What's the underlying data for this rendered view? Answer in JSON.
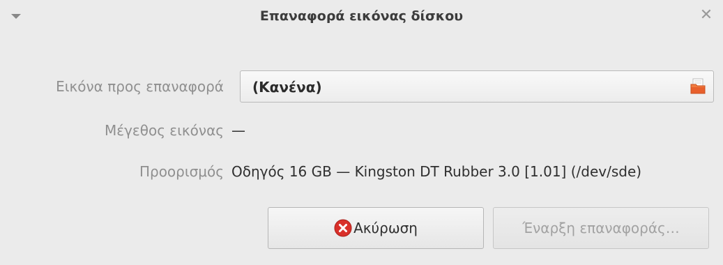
{
  "window": {
    "title": "Επαναφορά εικόνας δίσκου",
    "menu_icon": "triangle-down-icon",
    "close_glyph": "✕"
  },
  "form": {
    "image_label": "Εικόνα προς επαναφορά",
    "image_value": "(Κανένα)",
    "image_icon": "folder-icon",
    "size_label": "Μέγεθος εικόνας",
    "size_value": "—",
    "destination_label": "Προορισμός",
    "destination_value": "Οδηγός 16 GB — Kingston DT Rubber 3.0 [1.01] (/dev/sde)"
  },
  "buttons": {
    "cancel_label": "Ακύρωση",
    "cancel_icon": "cancel-icon",
    "start_label": "Έναρξη επαναφοράς…"
  },
  "colors": {
    "background": "#ebebeb",
    "label_gray": "#8f8f8f",
    "cancel_red": "#d9302a",
    "folder_orange": "#e8602c"
  }
}
